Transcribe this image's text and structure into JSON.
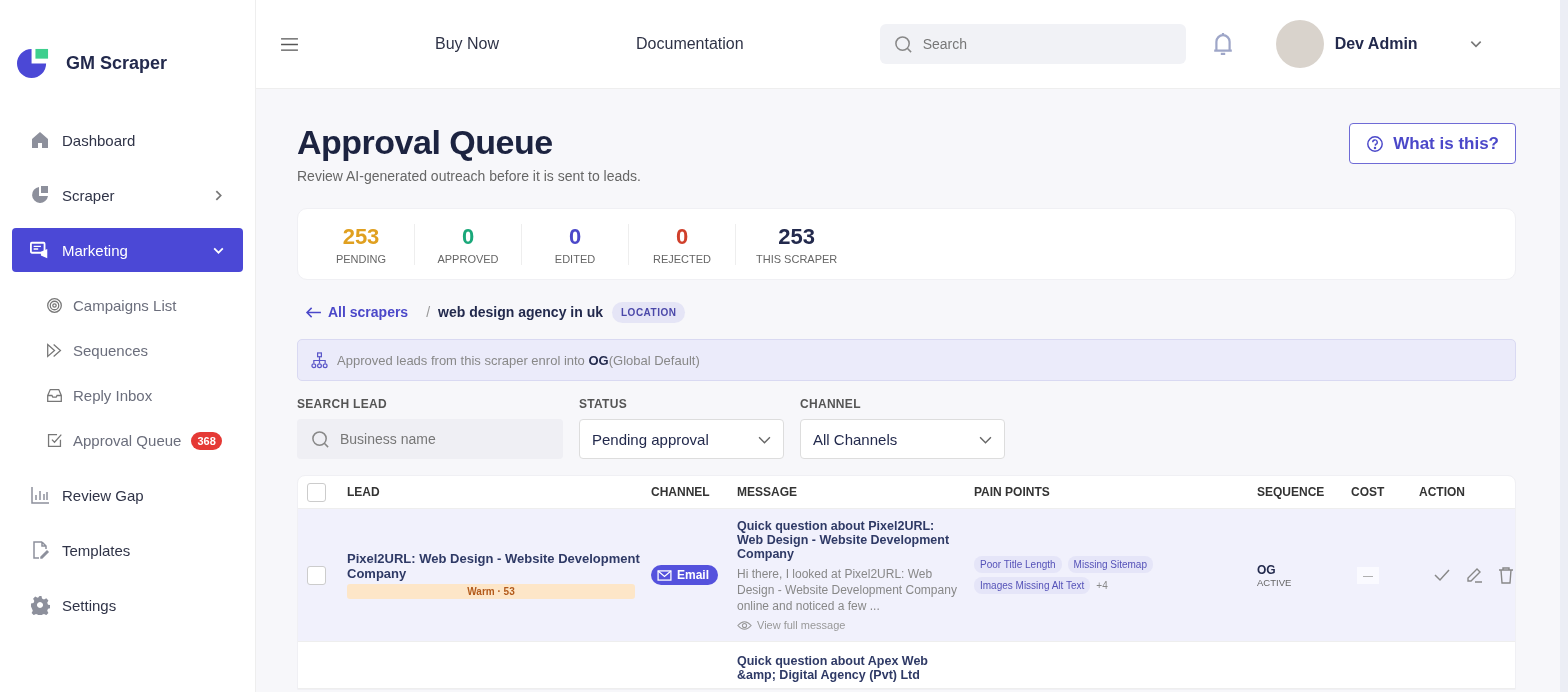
{
  "brand": {
    "name": "GM Scraper"
  },
  "sidebar": {
    "items": [
      {
        "kind": "main",
        "label": "Dashboard",
        "selected": false
      },
      {
        "kind": "main",
        "label": "Scraper",
        "selected": false,
        "expanded": false
      },
      {
        "kind": "main",
        "label": "Marketing",
        "selected": true,
        "expanded": true,
        "children": [
          {
            "label": "Campaigns List"
          },
          {
            "label": "Sequences"
          },
          {
            "label": "Reply Inbox"
          },
          {
            "label": "Approval Queue",
            "badge": "368"
          }
        ]
      },
      {
        "kind": "main",
        "label": "Review Gap",
        "selected": false
      },
      {
        "kind": "main",
        "label": "Templates",
        "selected": false
      },
      {
        "kind": "main",
        "label": "Settings",
        "selected": false
      }
    ]
  },
  "header": {
    "links": [
      "Buy Now",
      "Documentation"
    ],
    "search": {
      "placeholder": "Search"
    },
    "user": {
      "name": "Dev Admin"
    }
  },
  "page": {
    "title": "Approval Queue",
    "subtitle": "Review AI-generated outreach before it is sent to leads.",
    "help_button": "What is this?"
  },
  "stats": [
    {
      "value": "253",
      "label": "PENDING",
      "color": "#e0a020"
    },
    {
      "value": "0",
      "label": "APPROVED",
      "color": "#1aa87a"
    },
    {
      "value": "0",
      "label": "EDITED",
      "color": "#4b48c9"
    },
    {
      "value": "0",
      "label": "REJECTED",
      "color": "#d0402c"
    },
    {
      "value": "253",
      "label": "THIS SCRAPER",
      "color": "#232a4d"
    }
  ],
  "breadcrumb": {
    "back": "All scrapers",
    "separator": "/",
    "current": "web design agency in uk",
    "tag": "LOCATION"
  },
  "notice": {
    "text": "Approved leads from this scraper enrol into **OG**(Global Default)"
  },
  "filters": [
    {
      "kind": "search",
      "label": "SEARCH LEAD",
      "placeholder": "Business name"
    },
    {
      "kind": "select",
      "label": "STATUS",
      "value": "Pending approval"
    },
    {
      "kind": "select",
      "label": "CHANNEL",
      "value": "All Channels"
    }
  ],
  "table": {
    "select_all": {
      "checked": false
    },
    "columns": [
      "LEAD",
      "CHANNEL",
      "MESSAGE",
      "PAIN POINTS",
      "SEQUENCE",
      "COST",
      "ACTION"
    ],
    "rows": [
      {
        "hovered": true,
        "checked": false,
        "lead": "Pixel2URL: Web Design - Website Development Company",
        "score": "Warm · 53",
        "channel": "Email",
        "message_title": "Quick question about Pixel2URL: Web Design - Website Development Company",
        "message_preview": "Hi there, I looked at Pixel2URL: Web Design - Website Development Company online and noticed a few ...",
        "view_link": "View full message",
        "pain_points": [
          "Poor Title Length",
          "Missing Sitemap",
          "Images Missing Alt Text"
        ],
        "more": "+4",
        "sequence": "OG",
        "sequence_status": "ACTIVE",
        "cost": "—"
      },
      {
        "hovered": false,
        "message_title": "Quick question about Apex Web &amp; Digital Agency (Pvt) Ltd"
      }
    ]
  }
}
